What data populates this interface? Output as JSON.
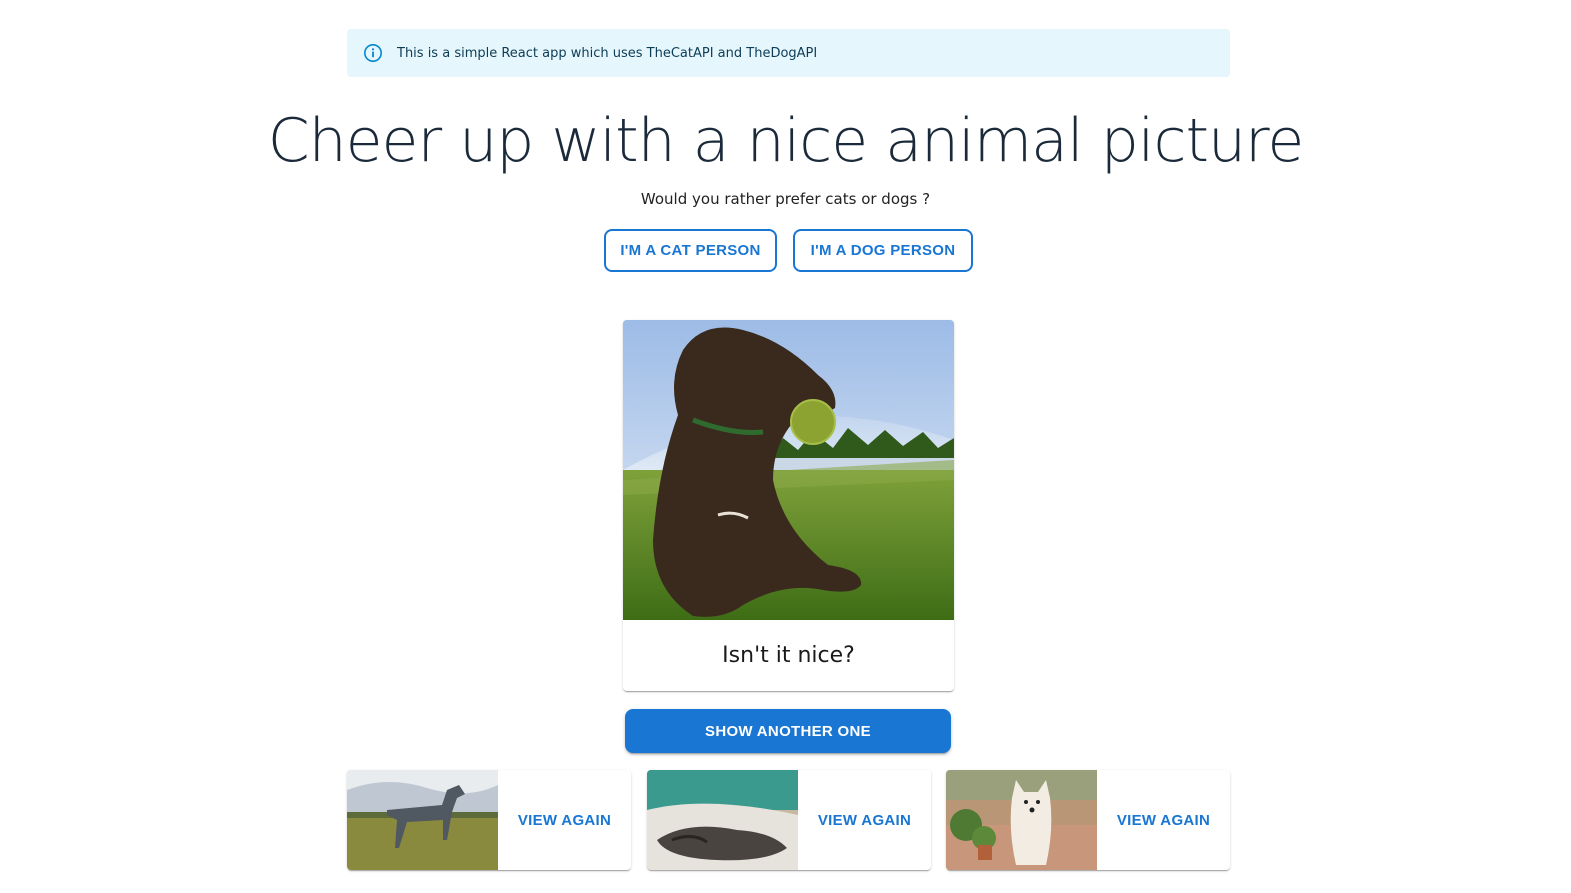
{
  "banner": {
    "text": "This is a simple React app which uses TheCatAPI and TheDogAPI",
    "icon": "info-icon"
  },
  "title": "Cheer up with a nice animal picture",
  "question": "Would you rather prefer cats or dogs ?",
  "buttons": {
    "cat": "I'M A CAT PERSON",
    "dog": "I'M A DOG PERSON",
    "show_another": "SHOW ANOTHER ONE"
  },
  "main_card": {
    "caption": "Isn't it nice?"
  },
  "history": [
    {
      "action": "VIEW AGAIN"
    },
    {
      "action": "VIEW AGAIN"
    },
    {
      "action": "VIEW AGAIN"
    }
  ],
  "colors": {
    "primary": "#1976d2",
    "alert_bg": "#e5f6fd",
    "alert_icon": "#0288d1"
  }
}
